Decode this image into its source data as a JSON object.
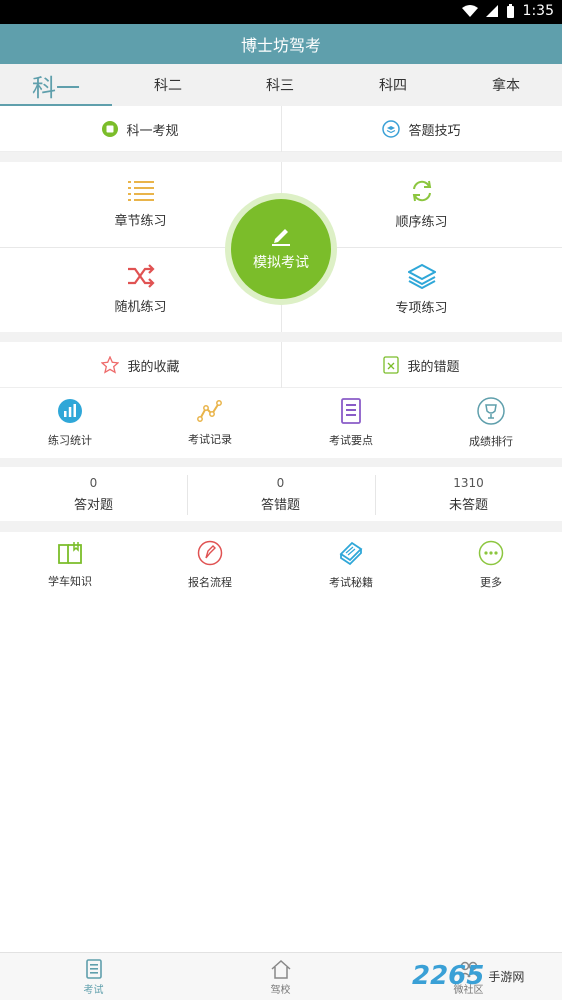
{
  "status": {
    "time": "1:35"
  },
  "app": {
    "title": "博士坊驾考"
  },
  "tabs": [
    {
      "label": "科一"
    },
    {
      "label": "科二"
    },
    {
      "label": "科三"
    },
    {
      "label": "科四"
    },
    {
      "label": "拿本"
    }
  ],
  "top_links": {
    "rules": "科一考规",
    "tips": "答题技巧"
  },
  "practice": {
    "chapter": "章节练习",
    "sequence": "顺序练习",
    "random": "随机练习",
    "special": "专项练习",
    "mock_exam": "模拟考试"
  },
  "favorites": {
    "collect": "我的收藏",
    "wrong": "我的错题"
  },
  "tools": [
    {
      "label": "练习统计"
    },
    {
      "label": "考试记录"
    },
    {
      "label": "考试要点"
    },
    {
      "label": "成绩排行"
    }
  ],
  "stats": [
    {
      "value": "0",
      "label": "答对题"
    },
    {
      "value": "0",
      "label": "答错题"
    },
    {
      "value": "1310",
      "label": "未答题"
    }
  ],
  "more": [
    {
      "label": "学车知识"
    },
    {
      "label": "报名流程"
    },
    {
      "label": "考试秘籍"
    },
    {
      "label": "更多"
    }
  ],
  "bottom_nav": [
    {
      "label": "考试"
    },
    {
      "label": "驾校"
    },
    {
      "label": "微社区"
    }
  ],
  "watermark": {
    "brand": "2265",
    "site": "手游网"
  },
  "colors": {
    "primary": "#5f9fac",
    "green": "#7bbd2a",
    "gap": "#f2f2f2"
  }
}
